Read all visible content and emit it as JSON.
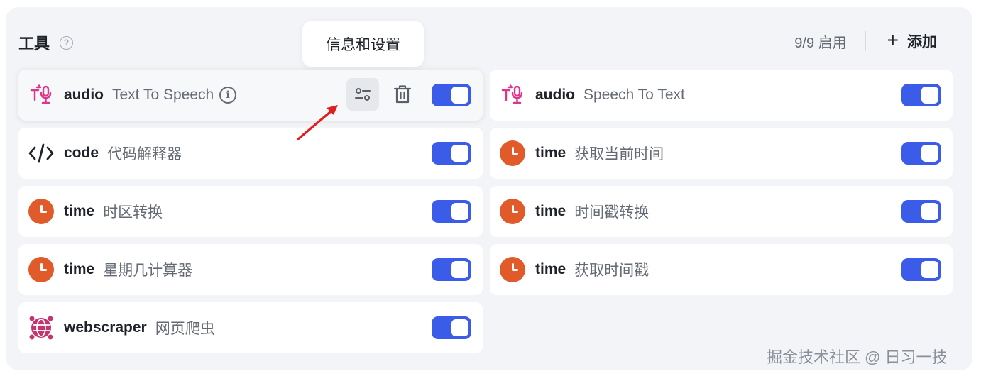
{
  "header": {
    "title": "工具",
    "enabled_count": "9/9 启用",
    "add_label": "添加"
  },
  "tooltip": {
    "text": "信息和设置"
  },
  "tools": [
    {
      "name": "audio",
      "desc": "Text To Speech",
      "icon": "text-to-speech-icon",
      "enabled": true
    },
    {
      "name": "audio",
      "desc": "Speech To Text",
      "icon": "speech-to-text-icon",
      "enabled": true
    },
    {
      "name": "code",
      "desc": "代码解释器",
      "icon": "code-icon",
      "enabled": true
    },
    {
      "name": "time",
      "desc": "获取当前时间",
      "icon": "clock-icon",
      "enabled": true
    },
    {
      "name": "time",
      "desc": "时区转换",
      "icon": "clock-icon",
      "enabled": true
    },
    {
      "name": "time",
      "desc": "时间戳转换",
      "icon": "clock-icon",
      "enabled": true
    },
    {
      "name": "time",
      "desc": "星期几计算器",
      "icon": "clock-icon",
      "enabled": true
    },
    {
      "name": "time",
      "desc": "获取时间戳",
      "icon": "clock-icon",
      "enabled": true
    },
    {
      "name": "webscraper",
      "desc": "网页爬虫",
      "icon": "webscraper-icon",
      "enabled": true
    }
  ],
  "watermark": "掘金技术社区 @ 日习一技",
  "colors": {
    "accent": "#3b5ce8",
    "clock": "#e05a2a",
    "audio": "#e0338a"
  }
}
